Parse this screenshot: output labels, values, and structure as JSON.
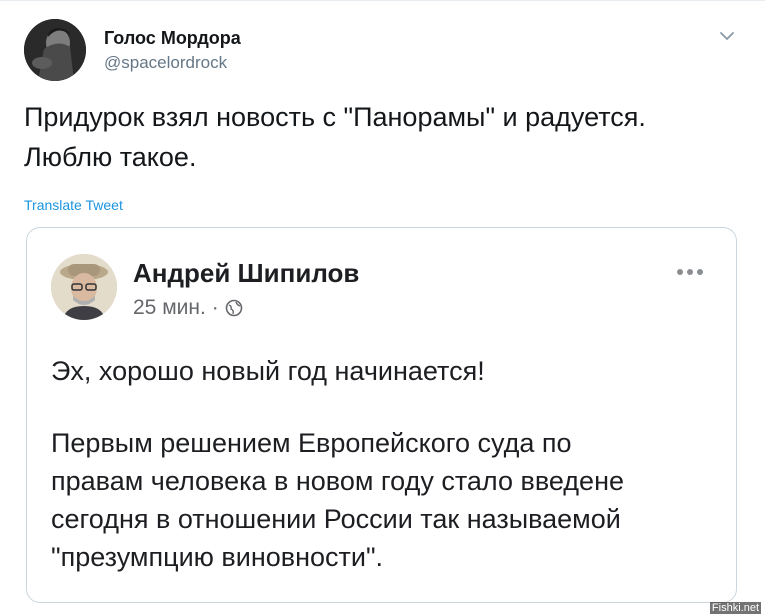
{
  "tweet": {
    "author_name": "Голос Мордора",
    "author_handle": "@spacelordrock",
    "text": "Придурок взял новость с \"Панорамы\" и радуется.\nЛюблю такое.",
    "translate_label": "Translate Tweet",
    "caret_icon": "chevron-down-icon"
  },
  "embedded_post": {
    "author_name": "Андрей Шипилов",
    "time": "25 мин.",
    "separator": "·",
    "visibility_icon": "globe-icon",
    "more_icon": "more-dots-icon",
    "paragraphs": [
      "Эх, хорошо новый год начинается!",
      "Первым решением Европейского суда по\nправам человека в новом году стало введене\nсегодня в отношении России так называемой\n\"презумпцию виновности\"."
    ]
  },
  "watermark": "Fishki.net",
  "colors": {
    "link": "#1b95e0",
    "secondary": "#657786",
    "border": "#ccd6dd"
  }
}
